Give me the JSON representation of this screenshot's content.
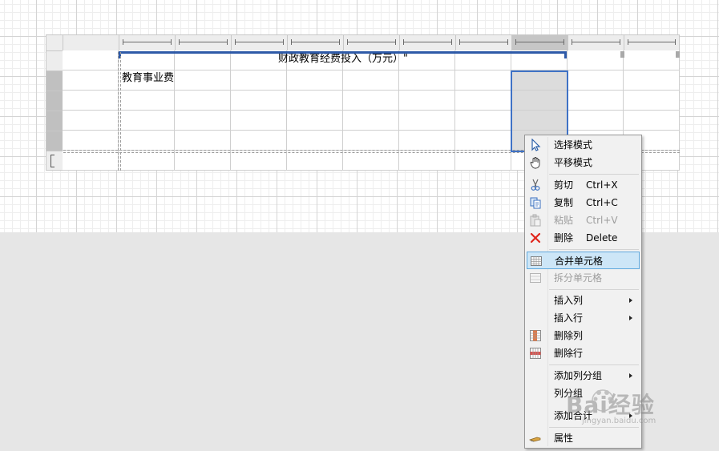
{
  "sheet": {
    "title_cell": "财政教育经费投入（万元）\"",
    "row_label": "教育事业费"
  },
  "context_menu": {
    "items": [
      {
        "id": "select-mode",
        "icon": "cursor-arrow-icon",
        "label": "选择模式",
        "shortcut": "",
        "disabled": false,
        "submenu": false
      },
      {
        "id": "pan-mode",
        "icon": "hand-icon",
        "label": "平移模式",
        "shortcut": "",
        "disabled": false,
        "submenu": false
      },
      {
        "id": "cut",
        "icon": "scissors-icon",
        "label": "剪切",
        "shortcut": "Ctrl+X",
        "disabled": false,
        "submenu": false
      },
      {
        "id": "copy",
        "icon": "copy-icon",
        "label": "复制",
        "shortcut": "Ctrl+C",
        "disabled": false,
        "submenu": false
      },
      {
        "id": "paste",
        "icon": "paste-icon",
        "label": "粘贴",
        "shortcut": "Ctrl+V",
        "disabled": true,
        "submenu": false
      },
      {
        "id": "delete",
        "icon": "red-x-icon",
        "label": "删除",
        "shortcut": "Delete",
        "disabled": false,
        "submenu": false
      },
      {
        "id": "merge-cells",
        "icon": "merge-cells-icon",
        "label": "合并单元格",
        "shortcut": "",
        "disabled": false,
        "submenu": false,
        "highlighted": true
      },
      {
        "id": "split-cells",
        "icon": "split-cells-icon",
        "label": "拆分单元格",
        "shortcut": "",
        "disabled": true,
        "submenu": false
      },
      {
        "id": "insert-column",
        "icon": "",
        "label": "插入列",
        "shortcut": "",
        "disabled": false,
        "submenu": true
      },
      {
        "id": "insert-row",
        "icon": "",
        "label": "插入行",
        "shortcut": "",
        "disabled": false,
        "submenu": true
      },
      {
        "id": "delete-column",
        "icon": "delete-column-icon",
        "label": "删除列",
        "shortcut": "",
        "disabled": false,
        "submenu": false
      },
      {
        "id": "delete-row",
        "icon": "delete-row-icon",
        "label": "删除行",
        "shortcut": "",
        "disabled": false,
        "submenu": false
      },
      {
        "id": "add-column-group",
        "icon": "",
        "label": "添加列分组",
        "shortcut": "",
        "disabled": false,
        "submenu": true
      },
      {
        "id": "column-group",
        "icon": "",
        "label": "列分组",
        "shortcut": "",
        "disabled": false,
        "submenu": false
      },
      {
        "id": "add-total",
        "icon": "",
        "label": "添加合计",
        "shortcut": "",
        "disabled": false,
        "submenu": true
      },
      {
        "id": "properties",
        "icon": "properties-icon",
        "label": "属性",
        "shortcut": "",
        "disabled": false,
        "submenu": false
      }
    ]
  },
  "watermark": {
    "text": "Bai经验",
    "sub": "jingyan.baidu.com"
  }
}
